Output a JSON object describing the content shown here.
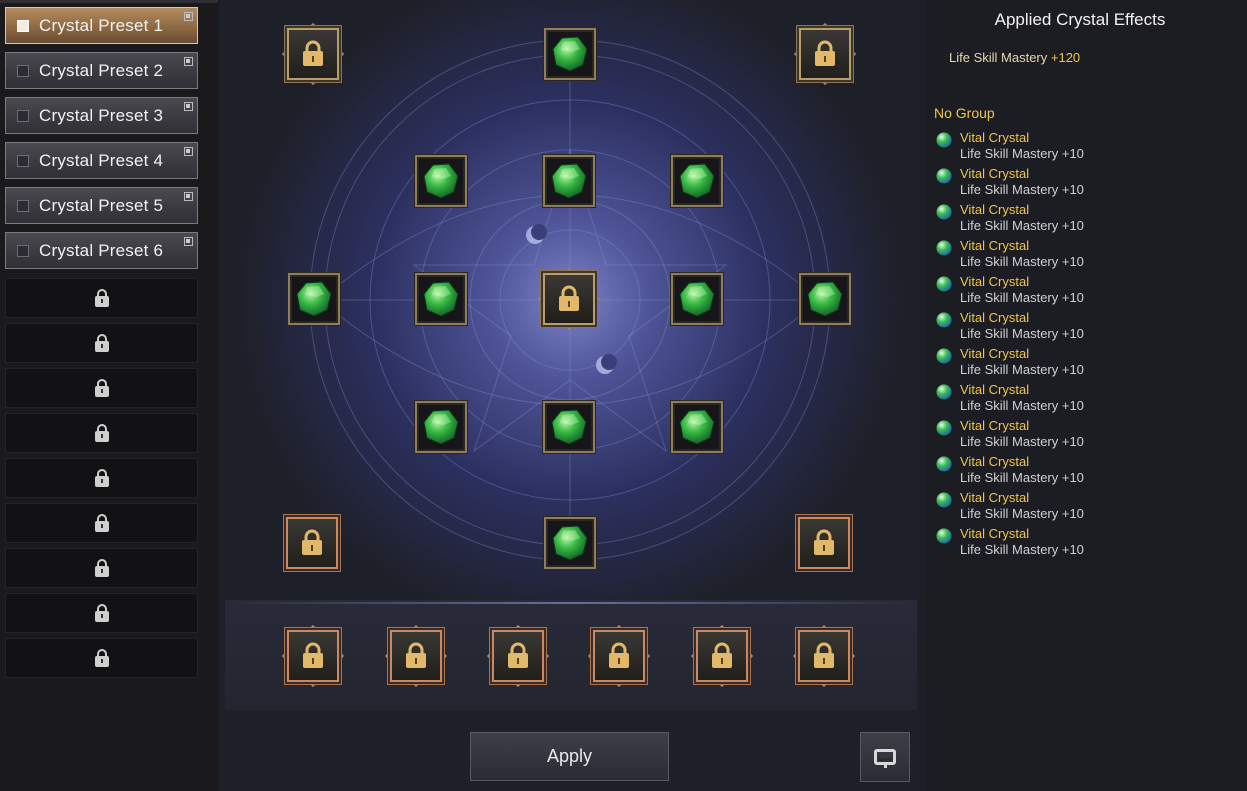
{
  "presets": [
    {
      "label": "Crystal Preset 1",
      "active": true
    },
    {
      "label": "Crystal Preset 2",
      "active": false
    },
    {
      "label": "Crystal Preset 3",
      "active": false
    },
    {
      "label": "Crystal Preset 4",
      "active": false
    },
    {
      "label": "Crystal Preset 5",
      "active": false
    },
    {
      "label": "Crystal Preset 6",
      "active": false
    }
  ],
  "locked_preset_slots": 9,
  "board": {
    "crystal_icon": "green-crystal-icon",
    "lock_icon": "padlock-icon",
    "equipped_count": 12
  },
  "buttons": {
    "apply_label": "Apply",
    "tray_icon": "inventory-tray-icon"
  },
  "effects": {
    "title": "Applied Crystal Effects",
    "total_stat": "Life Skill Mastery",
    "total_value": "+120",
    "group_label": "No Group",
    "items": [
      {
        "name": "Vital Crystal",
        "effect": "Life Skill Mastery +10"
      },
      {
        "name": "Vital Crystal",
        "effect": "Life Skill Mastery +10"
      },
      {
        "name": "Vital Crystal",
        "effect": "Life Skill Mastery +10"
      },
      {
        "name": "Vital Crystal",
        "effect": "Life Skill Mastery +10"
      },
      {
        "name": "Vital Crystal",
        "effect": "Life Skill Mastery +10"
      },
      {
        "name": "Vital Crystal",
        "effect": "Life Skill Mastery +10"
      },
      {
        "name": "Vital Crystal",
        "effect": "Life Skill Mastery +10"
      },
      {
        "name": "Vital Crystal",
        "effect": "Life Skill Mastery +10"
      },
      {
        "name": "Vital Crystal",
        "effect": "Life Skill Mastery +10"
      },
      {
        "name": "Vital Crystal",
        "effect": "Life Skill Mastery +10"
      },
      {
        "name": "Vital Crystal",
        "effect": "Life Skill Mastery +10"
      },
      {
        "name": "Vital Crystal",
        "effect": "Life Skill Mastery +10"
      }
    ]
  },
  "colors": {
    "accent_gold": "#f0c64a",
    "active_preset": "#a07a50",
    "crystal_green": "#3fbf4a"
  }
}
